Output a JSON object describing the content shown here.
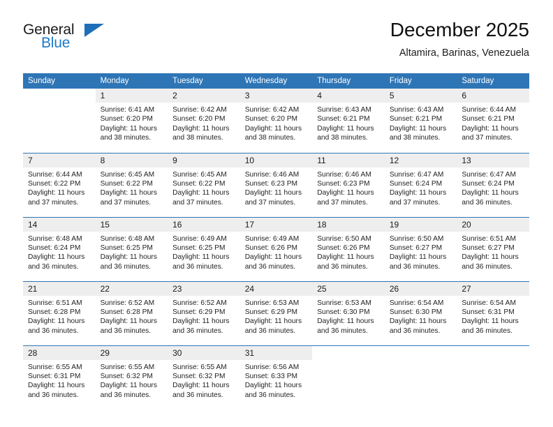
{
  "brand": {
    "name_top": "General",
    "name_bottom": "Blue",
    "accent_color": "#1f7ac4",
    "flag_icon": "triangle-flag-icon"
  },
  "header": {
    "month_title": "December 2025",
    "location": "Altamira, Barinas, Venezuela"
  },
  "calendar": {
    "header_color": "#2e75b6",
    "daynum_band_color": "#eeeeee",
    "weekday_headers": [
      "Sunday",
      "Monday",
      "Tuesday",
      "Wednesday",
      "Thursday",
      "Friday",
      "Saturday"
    ],
    "labels": {
      "sunrise_prefix": "Sunrise:",
      "sunset_prefix": "Sunset:",
      "daylight_prefix": "Daylight:"
    },
    "weeks": [
      [
        {
          "day": "",
          "sunrise": "",
          "sunset": "",
          "daylight": ""
        },
        {
          "day": "1",
          "sunrise": "Sunrise: 6:41 AM",
          "sunset": "Sunset: 6:20 PM",
          "daylight": "Daylight: 11 hours and 38 minutes."
        },
        {
          "day": "2",
          "sunrise": "Sunrise: 6:42 AM",
          "sunset": "Sunset: 6:20 PM",
          "daylight": "Daylight: 11 hours and 38 minutes."
        },
        {
          "day": "3",
          "sunrise": "Sunrise: 6:42 AM",
          "sunset": "Sunset: 6:20 PM",
          "daylight": "Daylight: 11 hours and 38 minutes."
        },
        {
          "day": "4",
          "sunrise": "Sunrise: 6:43 AM",
          "sunset": "Sunset: 6:21 PM",
          "daylight": "Daylight: 11 hours and 38 minutes."
        },
        {
          "day": "5",
          "sunrise": "Sunrise: 6:43 AM",
          "sunset": "Sunset: 6:21 PM",
          "daylight": "Daylight: 11 hours and 38 minutes."
        },
        {
          "day": "6",
          "sunrise": "Sunrise: 6:44 AM",
          "sunset": "Sunset: 6:21 PM",
          "daylight": "Daylight: 11 hours and 37 minutes."
        }
      ],
      [
        {
          "day": "7",
          "sunrise": "Sunrise: 6:44 AM",
          "sunset": "Sunset: 6:22 PM",
          "daylight": "Daylight: 11 hours and 37 minutes."
        },
        {
          "day": "8",
          "sunrise": "Sunrise: 6:45 AM",
          "sunset": "Sunset: 6:22 PM",
          "daylight": "Daylight: 11 hours and 37 minutes."
        },
        {
          "day": "9",
          "sunrise": "Sunrise: 6:45 AM",
          "sunset": "Sunset: 6:22 PM",
          "daylight": "Daylight: 11 hours and 37 minutes."
        },
        {
          "day": "10",
          "sunrise": "Sunrise: 6:46 AM",
          "sunset": "Sunset: 6:23 PM",
          "daylight": "Daylight: 11 hours and 37 minutes."
        },
        {
          "day": "11",
          "sunrise": "Sunrise: 6:46 AM",
          "sunset": "Sunset: 6:23 PM",
          "daylight": "Daylight: 11 hours and 37 minutes."
        },
        {
          "day": "12",
          "sunrise": "Sunrise: 6:47 AM",
          "sunset": "Sunset: 6:24 PM",
          "daylight": "Daylight: 11 hours and 37 minutes."
        },
        {
          "day": "13",
          "sunrise": "Sunrise: 6:47 AM",
          "sunset": "Sunset: 6:24 PM",
          "daylight": "Daylight: 11 hours and 36 minutes."
        }
      ],
      [
        {
          "day": "14",
          "sunrise": "Sunrise: 6:48 AM",
          "sunset": "Sunset: 6:24 PM",
          "daylight": "Daylight: 11 hours and 36 minutes."
        },
        {
          "day": "15",
          "sunrise": "Sunrise: 6:48 AM",
          "sunset": "Sunset: 6:25 PM",
          "daylight": "Daylight: 11 hours and 36 minutes."
        },
        {
          "day": "16",
          "sunrise": "Sunrise: 6:49 AM",
          "sunset": "Sunset: 6:25 PM",
          "daylight": "Daylight: 11 hours and 36 minutes."
        },
        {
          "day": "17",
          "sunrise": "Sunrise: 6:49 AM",
          "sunset": "Sunset: 6:26 PM",
          "daylight": "Daylight: 11 hours and 36 minutes."
        },
        {
          "day": "18",
          "sunrise": "Sunrise: 6:50 AM",
          "sunset": "Sunset: 6:26 PM",
          "daylight": "Daylight: 11 hours and 36 minutes."
        },
        {
          "day": "19",
          "sunrise": "Sunrise: 6:50 AM",
          "sunset": "Sunset: 6:27 PM",
          "daylight": "Daylight: 11 hours and 36 minutes."
        },
        {
          "day": "20",
          "sunrise": "Sunrise: 6:51 AM",
          "sunset": "Sunset: 6:27 PM",
          "daylight": "Daylight: 11 hours and 36 minutes."
        }
      ],
      [
        {
          "day": "21",
          "sunrise": "Sunrise: 6:51 AM",
          "sunset": "Sunset: 6:28 PM",
          "daylight": "Daylight: 11 hours and 36 minutes."
        },
        {
          "day": "22",
          "sunrise": "Sunrise: 6:52 AM",
          "sunset": "Sunset: 6:28 PM",
          "daylight": "Daylight: 11 hours and 36 minutes."
        },
        {
          "day": "23",
          "sunrise": "Sunrise: 6:52 AM",
          "sunset": "Sunset: 6:29 PM",
          "daylight": "Daylight: 11 hours and 36 minutes."
        },
        {
          "day": "24",
          "sunrise": "Sunrise: 6:53 AM",
          "sunset": "Sunset: 6:29 PM",
          "daylight": "Daylight: 11 hours and 36 minutes."
        },
        {
          "day": "25",
          "sunrise": "Sunrise: 6:53 AM",
          "sunset": "Sunset: 6:30 PM",
          "daylight": "Daylight: 11 hours and 36 minutes."
        },
        {
          "day": "26",
          "sunrise": "Sunrise: 6:54 AM",
          "sunset": "Sunset: 6:30 PM",
          "daylight": "Daylight: 11 hours and 36 minutes."
        },
        {
          "day": "27",
          "sunrise": "Sunrise: 6:54 AM",
          "sunset": "Sunset: 6:31 PM",
          "daylight": "Daylight: 11 hours and 36 minutes."
        }
      ],
      [
        {
          "day": "28",
          "sunrise": "Sunrise: 6:55 AM",
          "sunset": "Sunset: 6:31 PM",
          "daylight": "Daylight: 11 hours and 36 minutes."
        },
        {
          "day": "29",
          "sunrise": "Sunrise: 6:55 AM",
          "sunset": "Sunset: 6:32 PM",
          "daylight": "Daylight: 11 hours and 36 minutes."
        },
        {
          "day": "30",
          "sunrise": "Sunrise: 6:55 AM",
          "sunset": "Sunset: 6:32 PM",
          "daylight": "Daylight: 11 hours and 36 minutes."
        },
        {
          "day": "31",
          "sunrise": "Sunrise: 6:56 AM",
          "sunset": "Sunset: 6:33 PM",
          "daylight": "Daylight: 11 hours and 36 minutes."
        },
        {
          "day": "",
          "sunrise": "",
          "sunset": "",
          "daylight": ""
        },
        {
          "day": "",
          "sunrise": "",
          "sunset": "",
          "daylight": ""
        },
        {
          "day": "",
          "sunrise": "",
          "sunset": "",
          "daylight": ""
        }
      ]
    ]
  }
}
